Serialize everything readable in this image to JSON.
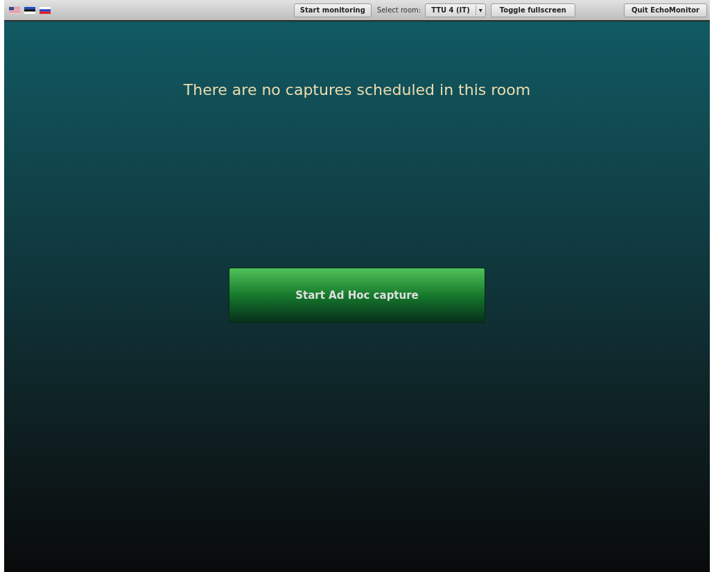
{
  "languages": [
    {
      "kind": "us"
    },
    {
      "kind": "ee"
    },
    {
      "kind": "ru"
    }
  ],
  "toolbar": {
    "start_button": "Start monitoring",
    "room_label": "Select room:",
    "room_select": {
      "value": "TTU 4 (IT)",
      "caret": "▾"
    },
    "fullscreen_button": "Toggle fullscreen",
    "quit_button": "Quit EchoMonitor"
  },
  "message": "There are no captures scheduled in this room",
  "capture_button": "Start Ad Hoc capture"
}
